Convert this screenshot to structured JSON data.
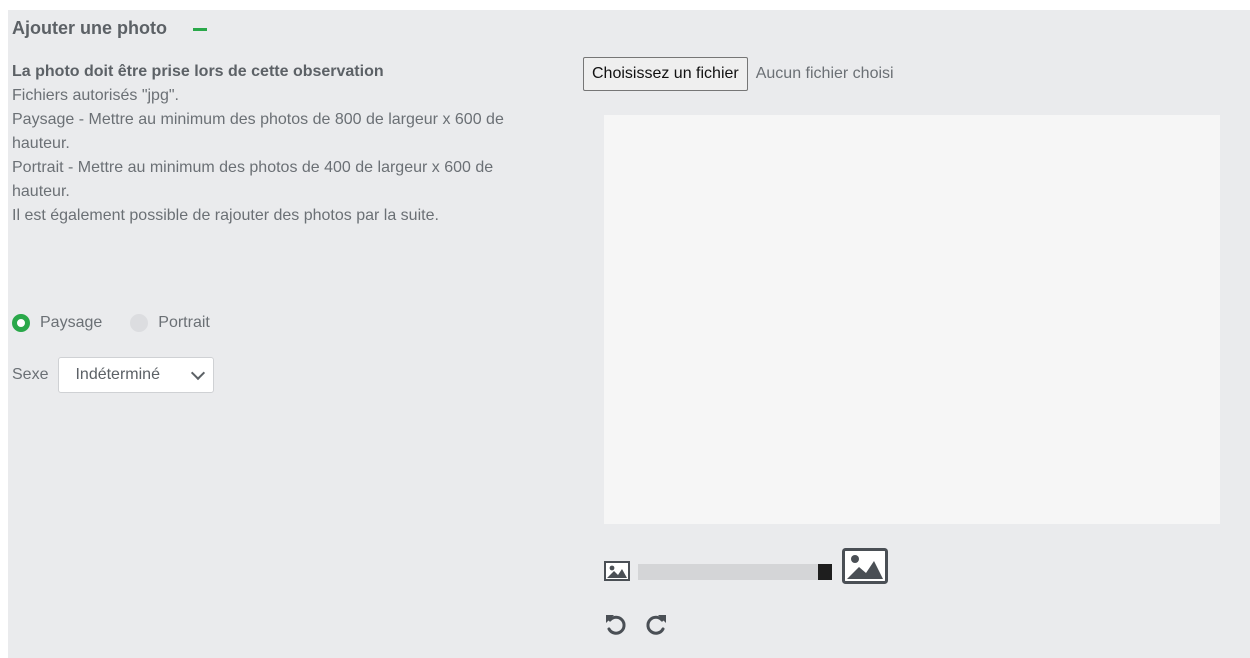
{
  "section": {
    "title": "Ajouter une photo"
  },
  "instructions": {
    "lead": "La photo doit être prise lors de cette observation",
    "lines": [
      "Fichiers autorisés \"jpg\".",
      "Paysage - Mettre au minimum des photos de 800 de largeur x 600 de hauteur.",
      "Portrait - Mettre au minimum des photos de 400 de largeur x 600 de hauteur.",
      "Il est également possible de rajouter des photos par la suite."
    ]
  },
  "orientation": {
    "options": [
      {
        "label": "Paysage",
        "selected": true
      },
      {
        "label": "Portrait",
        "selected": false
      }
    ]
  },
  "sex": {
    "label": "Sexe",
    "value": "Indéterminé"
  },
  "file": {
    "button_label": "Choisissez un fichier",
    "status": "Aucun fichier choisi"
  },
  "zoom": {
    "level_fraction": 1.0
  },
  "icons": {
    "collapse": "minus-icon",
    "zoom_out": "image-small-icon",
    "zoom_in": "image-large-icon",
    "rotate_left": "rotate-left-icon",
    "rotate_right": "rotate-right-icon",
    "dropdown": "chevron-down-icon"
  },
  "colors": {
    "accent": "#2aa84a",
    "panel_background": "#eaebed",
    "preview_background": "#f6f6f6",
    "text": "#6b7075"
  }
}
